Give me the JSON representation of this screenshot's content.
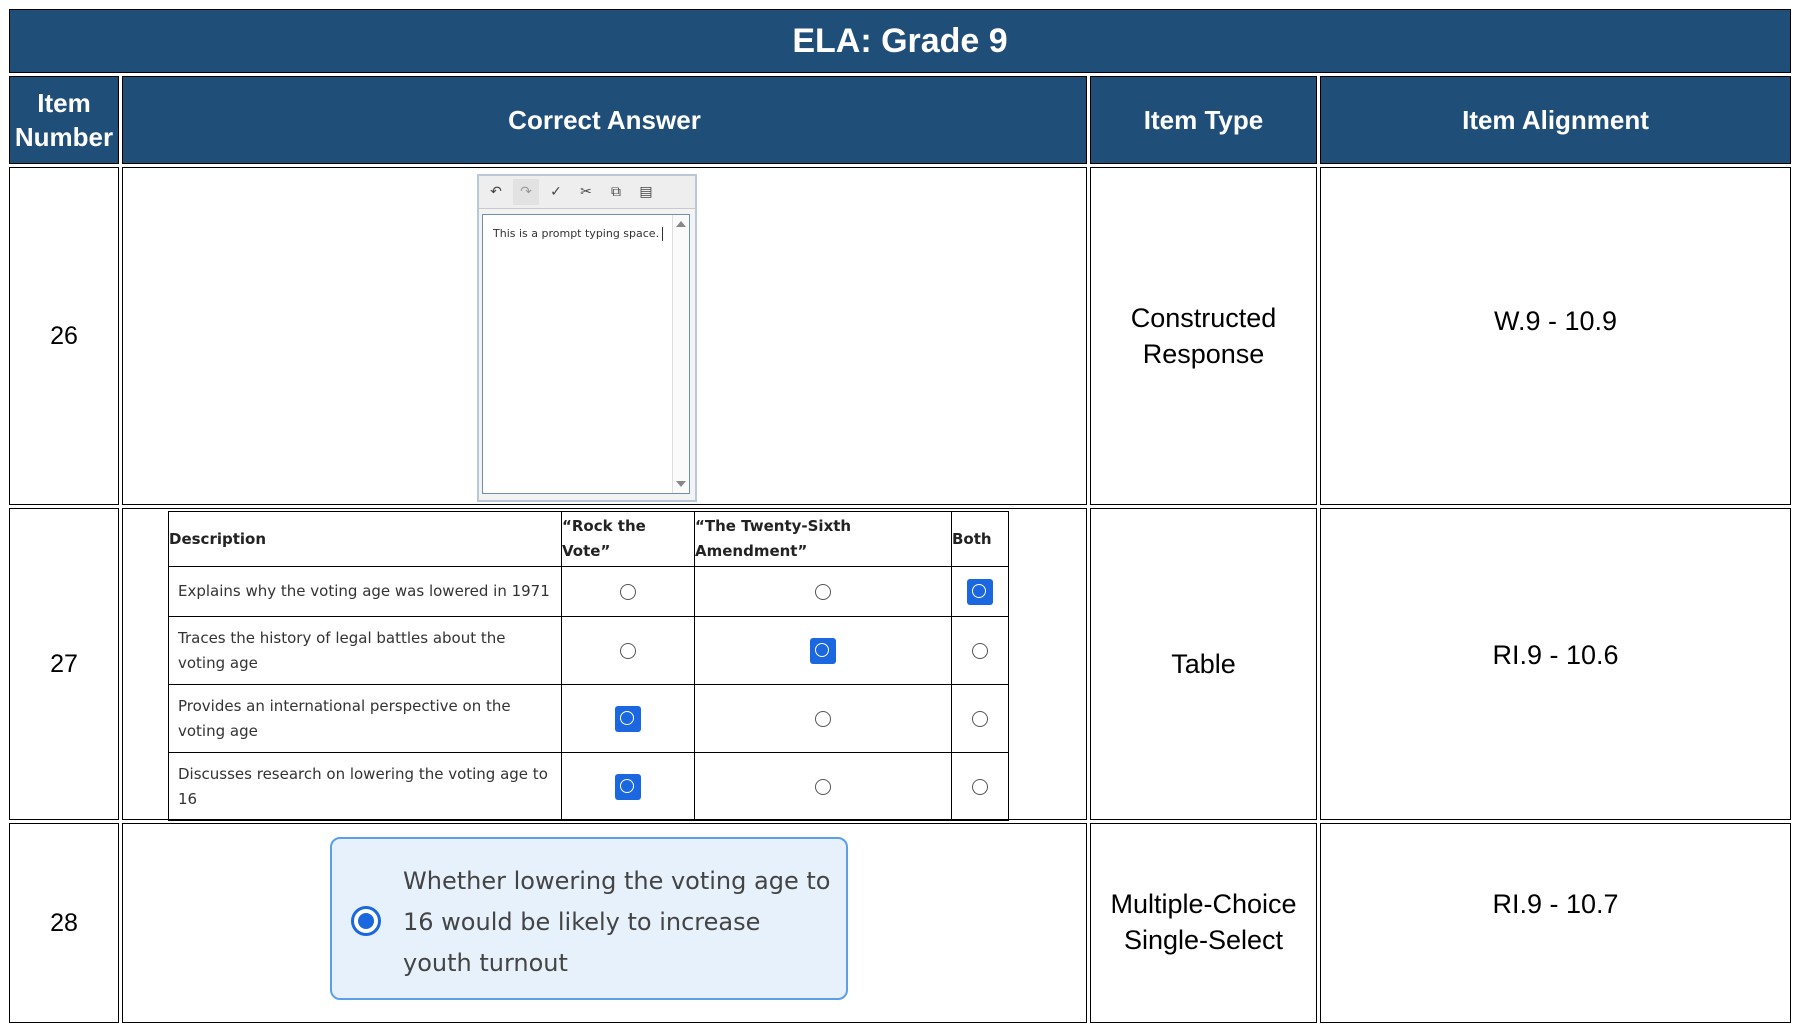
{
  "title": "ELA: Grade 9",
  "headers": {
    "item_number": "Item Number",
    "correct_answer": "Correct Answer",
    "item_type": "Item Type",
    "item_alignment": "Item Alignment"
  },
  "rows": [
    {
      "number": "26",
      "type": "Constructed Response",
      "alignment": "W.9 - 10.9",
      "editor": {
        "text": "This is a prompt typing space.",
        "toolbar_icons": [
          "undo-icon",
          "redo-icon",
          "spellcheck-icon",
          "cut-icon",
          "copy-icon",
          "paste-icon"
        ]
      }
    },
    {
      "number": "27",
      "type": "Table",
      "alignment": "RI.9 - 10.6",
      "table": {
        "headers": [
          "Description",
          "“Rock the Vote”",
          "“The Twenty-Sixth Amendment”",
          "Both"
        ],
        "rows": [
          {
            "description": "Explains why the voting age was lowered in 1971",
            "selected": 3
          },
          {
            "description": "Traces the history of legal battles about the voting age",
            "selected": 2
          },
          {
            "description": "Provides an international perspective on the voting age",
            "selected": 1
          },
          {
            "description": "Discusses research on lowering the voting age to 16",
            "selected": 1
          }
        ]
      }
    },
    {
      "number": "28",
      "type": "Multiple-Choice Single-Select",
      "alignment": "RI.9 - 10.7",
      "choice": {
        "text": "Whether lowering the voting age to 16 would be likely to increase youth turnout",
        "selected": true
      }
    }
  ],
  "colors": {
    "header_bg": "#1f4e79",
    "selected_blue": "#1a67e0",
    "choice_bg": "#e6f1fc",
    "choice_border": "#5ba0e5"
  }
}
